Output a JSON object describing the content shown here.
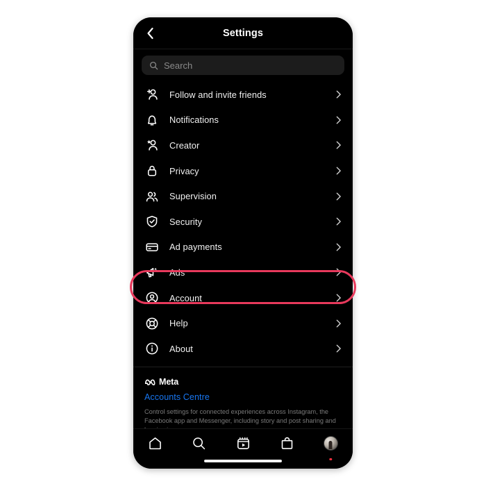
{
  "header": {
    "title": "Settings",
    "back_icon": "chevron-left-icon"
  },
  "search": {
    "placeholder": "Search",
    "icon": "search-icon"
  },
  "menu": {
    "items": [
      {
        "label": "Follow and invite friends",
        "icon": "add-person-icon",
        "chevron": "chevron-right-icon",
        "highlighted": false
      },
      {
        "label": "Notifications",
        "icon": "bell-icon",
        "chevron": "chevron-right-icon",
        "highlighted": false
      },
      {
        "label": "Creator",
        "icon": "star-person-icon",
        "chevron": "chevron-right-icon",
        "highlighted": false
      },
      {
        "label": "Privacy",
        "icon": "lock-icon",
        "chevron": "chevron-right-icon",
        "highlighted": false
      },
      {
        "label": "Supervision",
        "icon": "people-icon",
        "chevron": "chevron-right-icon",
        "highlighted": false
      },
      {
        "label": "Security",
        "icon": "shield-check-icon",
        "chevron": "chevron-right-icon",
        "highlighted": false
      },
      {
        "label": "Ad payments",
        "icon": "credit-card-icon",
        "chevron": "chevron-right-icon",
        "highlighted": false
      },
      {
        "label": "Ads",
        "icon": "megaphone-icon",
        "chevron": "chevron-right-icon",
        "highlighted": false
      },
      {
        "label": "Account",
        "icon": "account-circle-icon",
        "chevron": "chevron-right-icon",
        "highlighted": true
      },
      {
        "label": "Help",
        "icon": "lifebuoy-icon",
        "chevron": "chevron-right-icon",
        "highlighted": false
      },
      {
        "label": "About",
        "icon": "info-circle-icon",
        "chevron": "chevron-right-icon",
        "highlighted": false
      }
    ]
  },
  "meta_section": {
    "brand": "Meta",
    "brand_icon": "meta-infinity-icon",
    "link_label": "Accounts Centre",
    "link_color": "#1877f2",
    "description": "Control settings for connected experiences across Instagram, the Facebook app and Messenger, including story and post sharing and logging in."
  },
  "tabbar": {
    "items": [
      {
        "name": "home",
        "icon": "home-icon",
        "badge": false
      },
      {
        "name": "search",
        "icon": "search-icon",
        "badge": false
      },
      {
        "name": "reels",
        "icon": "reels-icon",
        "badge": false
      },
      {
        "name": "shop",
        "icon": "shop-bag-icon",
        "badge": false
      },
      {
        "name": "profile",
        "icon": "avatar-icon",
        "badge": true
      }
    ]
  },
  "annotation": {
    "target": "Account",
    "shape": "rounded-rectangle",
    "color": "#e8395c"
  }
}
